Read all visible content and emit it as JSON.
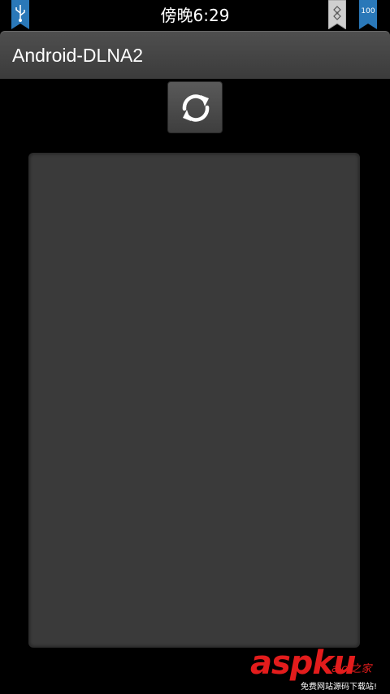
{
  "status_bar": {
    "time": "傍晚6:29",
    "battery_level": "100",
    "icons": [
      "usb-icon",
      "debug-icon",
      "battery-icon"
    ]
  },
  "app": {
    "title": "Android-DLNA2"
  },
  "toolbar": {
    "refresh_icon": "refresh-icon"
  },
  "device_list": {
    "items": []
  },
  "watermark": {
    "main": "aspku",
    "cn": "a.c.之家",
    "sub": "免费网站源码下载站!"
  },
  "colors": {
    "background": "#000000",
    "title_bar": "#444444",
    "panel": "#3a3a3a",
    "ribbon_blue": "#2a78b8",
    "ribbon_grey": "#cfcfcf",
    "watermark_red": "#e31c1c"
  }
}
